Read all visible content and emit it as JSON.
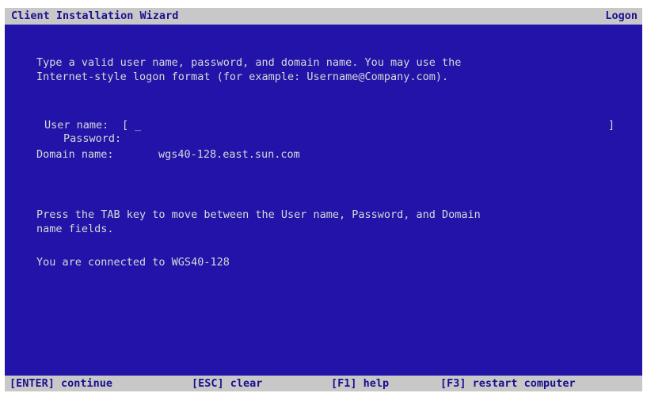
{
  "header": {
    "title": "Client Installation Wizard",
    "screen_name": "Logon"
  },
  "instructions": {
    "line1": "Type a valid user name, password, and domain name. You may use the",
    "line2": "Internet-style logon format (for example: Username@Company.com)."
  },
  "form": {
    "user_name_label": "User name:",
    "user_name_open_bracket": "[",
    "user_name_value": "_",
    "user_name_close_bracket": "]",
    "password_label": "Password:",
    "domain_label": "Domain name:",
    "domain_value": "wgs40-128.east.sun.com"
  },
  "help": {
    "line1": "Press the TAB key to move between the User name, Password, and Domain",
    "line2": "name fields."
  },
  "status": {
    "connected": "You are connected to WGS40-128"
  },
  "footer": {
    "enter": "[ENTER] continue",
    "esc": "[ESC] clear",
    "f1": "[F1] help",
    "f3": "[F3] restart computer"
  },
  "colors": {
    "background": "#2214a8",
    "bar": "#c8c8c8",
    "bar_text": "#1a1090",
    "text": "#d8d8d8"
  }
}
